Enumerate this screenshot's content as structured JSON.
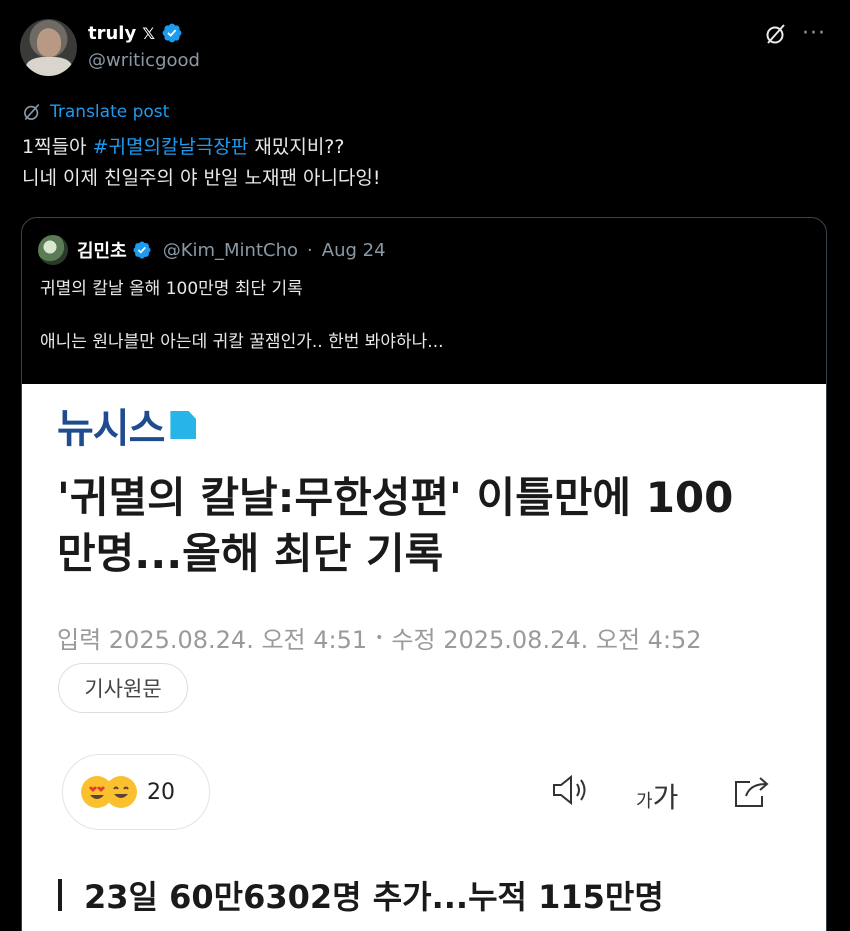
{
  "author": {
    "display_name": "truly",
    "x_badge": "𝕏",
    "handle": "@writicgood"
  },
  "translate_label": "Translate post",
  "tweet": {
    "line1_prefix": "1찍들아 ",
    "hashtag": "#귀멸의칼날극장판",
    "line1_suffix": " 재밌지비??",
    "line2": "니네 이제 친일주의 야 반일 노재팬 아니다잉!"
  },
  "quote": {
    "display_name": "김민초",
    "handle": "@Kim_MintCho",
    "separator": "·",
    "date": "Aug 24",
    "line1": "귀멸의 칼날 올해 100만명 최단 기록",
    "line2": "애니는 원나블만 아는데 귀칼 꿀잼인가.. 한번 봐야하나..."
  },
  "article": {
    "logo": "뉴시스",
    "headline_line1": "'귀멸의 칼날:무한성편' 이틀만에 100",
    "headline_line2": "만명...올해 최단 기록",
    "input_label": "입력 2025.08.24. 오전 4:51",
    "dot": "•",
    "edit_label": "수정 2025.08.24. 오전 4:52",
    "original_button": "기사원문",
    "reaction_count": "20",
    "font_small": "가",
    "font_large": "가",
    "subhead": "23일 60만6302명 추가...누적 115만명"
  },
  "colors": {
    "background": "#000000",
    "link": "#1d9bf0",
    "verified": "#1d9bf0",
    "muted": "#8b98a5",
    "newsis_blue": "#1f4b8f"
  }
}
